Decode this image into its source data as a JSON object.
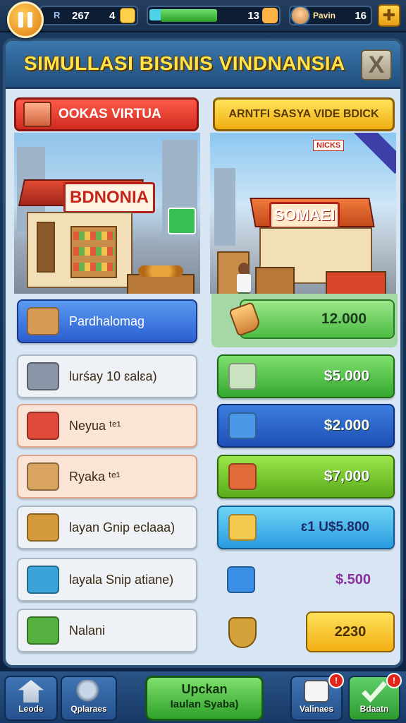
{
  "hud": {
    "res_a_label": "R",
    "res_a_value1": "267",
    "res_a_value2": "4",
    "res_b_value": "13",
    "player_name": "Pavin",
    "res_c_value": "16"
  },
  "panel": {
    "title": "SIMULLASI BISINIS VINDNANSIA",
    "close_label": "X",
    "tab_left": "OOKAS VIRTUA",
    "tab_right": "ARNTFI SASYA VIDE BDICK"
  },
  "scenes": {
    "left_sign": "BDNONIA",
    "right_sign": "SOMAEI",
    "right_chip": "NICKS"
  },
  "items": [
    {
      "label": "Pardhalomag",
      "style": "blue",
      "icon": "cardboard-box-icon"
    },
    {
      "label": "lurśay 10 ɛalɛa)",
      "style": "grey",
      "icon": "stone-block-icon"
    },
    {
      "label": "Neyua ᵗᵉ¹",
      "style": "peach",
      "icon": "fruit-crate-icon"
    },
    {
      "label": "Ryaka ᵗᵉ¹",
      "style": "peach",
      "icon": "parcel-icon"
    },
    {
      "label": "layan Gnip eclaaa)",
      "style": "grey",
      "icon": "bread-basket-icon"
    },
    {
      "label": "layala Snip atiane)",
      "style": "grey",
      "icon": "vegetable-box-icon"
    },
    {
      "label": "Nalani",
      "style": "grey",
      "icon": "green-crate-icon"
    }
  ],
  "prices": {
    "top": "12.000",
    "rows": [
      {
        "value": "$5.000",
        "style": "green",
        "icon": "cash-crate-icon"
      },
      {
        "value": "$2.000",
        "style": "blue",
        "icon": "plant-basket-icon"
      },
      {
        "value": "$7,000",
        "style": "lime",
        "icon": "sack-icon"
      },
      {
        "value": "ɛ1 U$5.800",
        "style": "cyan",
        "icon": "compass-icon"
      },
      {
        "value": "$.500",
        "style": "plain",
        "icon": "blue-star-box-icon"
      },
      {
        "value": "2230",
        "style": "yellow",
        "icon": "gold-shield-icon"
      }
    ]
  },
  "nav": {
    "home": "Leode",
    "search": "Qplaraes",
    "center_l1": "Upckan",
    "center_l2": "Iaulan Syaba)",
    "tasks": "Valinaes",
    "sell": "Bdaatn",
    "tasks_badge": "!",
    "sell_badge": "!"
  },
  "colors": {
    "accent_yellow": "#ffe44d",
    "panel_blue": "#2c5377",
    "buy_green": "#35a830",
    "tab_red": "#d02a20"
  }
}
